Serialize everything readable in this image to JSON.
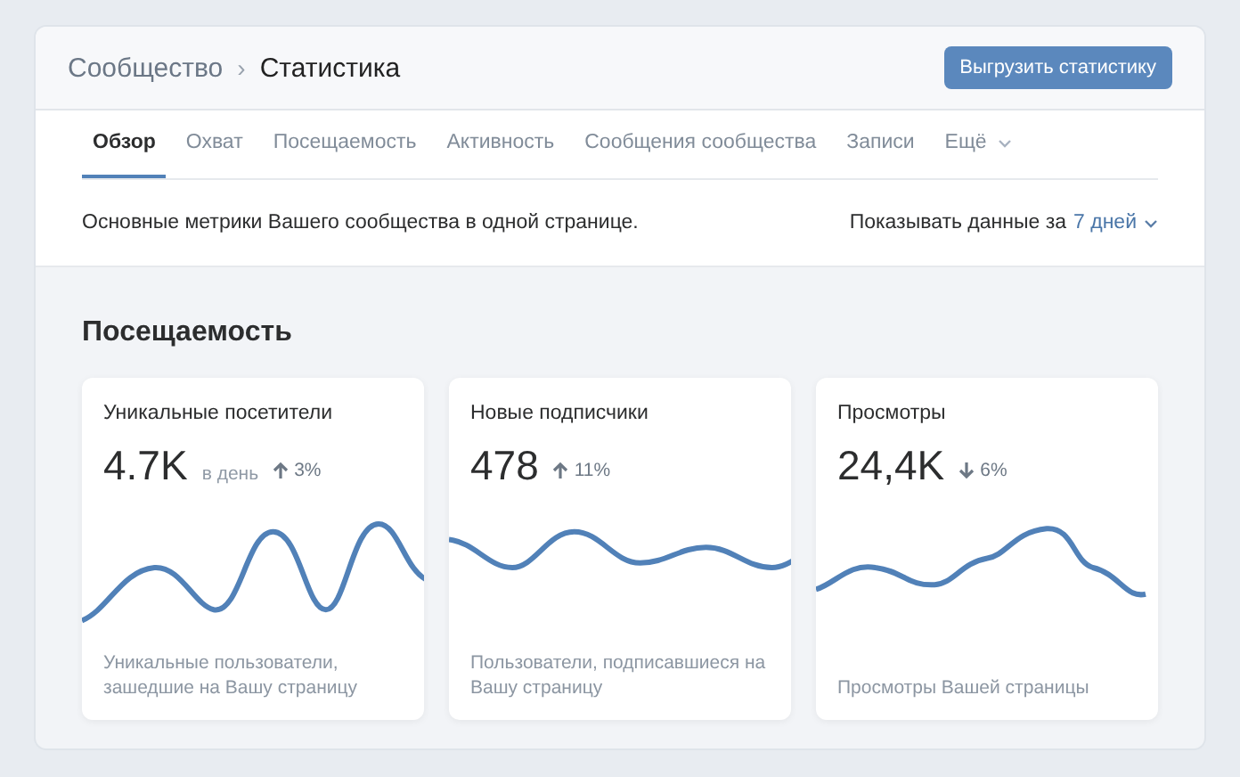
{
  "breadcrumbs": [
    {
      "label": "Сообщество"
    },
    {
      "label": "Статистика"
    }
  ],
  "breadcrumb_separator": "›",
  "export_button": "Выгрузить статистику",
  "tabs": [
    {
      "label": "Обзор",
      "selected": true
    },
    {
      "label": "Охват",
      "selected": false
    },
    {
      "label": "Посещаемость",
      "selected": false
    },
    {
      "label": "Активность",
      "selected": false
    },
    {
      "label": "Сообщения сообщества",
      "selected": false
    },
    {
      "label": "Записи",
      "selected": false
    },
    {
      "label": "Ещё",
      "selected": false,
      "kind": "dropdown"
    }
  ],
  "description": "Основные метрики Вашего сообщества в одной странице.",
  "period": {
    "label": "Показывать данные за",
    "value": "7 дней"
  },
  "section_title": "Посещаемость",
  "cards": [
    {
      "title": "Уникальные посетители",
      "value": "4.7K",
      "unit": "в день",
      "kind": "up",
      "change": "3%",
      "caption": "Уникальные пользователи, зашедшие на Вашу страницу"
    },
    {
      "title": "Новые подписчики",
      "value": "478",
      "kind": "up",
      "change": "11%",
      "caption": "Пользователи, подписавшиеся на Вашу страницу"
    },
    {
      "title": "Просмотры",
      "value": "24,4K",
      "kind": "down",
      "change": "6%",
      "caption": "Просмотры Вашей страницы"
    }
  ]
}
